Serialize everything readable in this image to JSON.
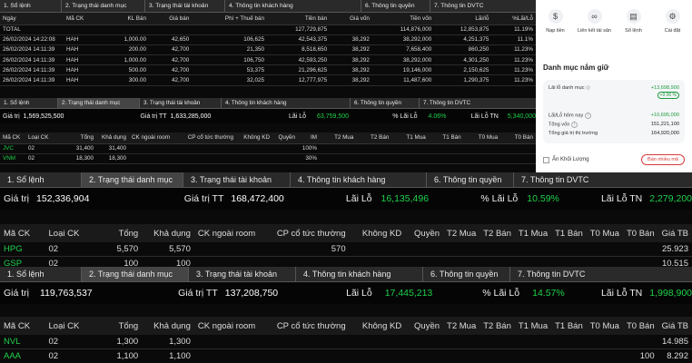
{
  "tabs": [
    "1. Sổ lệnh",
    "2. Trạng thái danh mục",
    "3. Trạng thái tài khoản",
    "4. Thông tin khách hàng",
    "6. Thông tin quyền",
    "7. Thông tin DVTC"
  ],
  "panel1": {
    "headers": [
      "Ngày",
      "Mã CK",
      "KL Bán",
      "Giá bán",
      "Phí + Thuế bán",
      "Tiền bán",
      "Giá vốn",
      "Tiền vốn",
      "Lãi/lỗ",
      "%Lãi/Lỗ"
    ],
    "total": {
      "label": "TOTAL",
      "tien_ban": "127,729,875",
      "tien_von": "114,876,000",
      "lai_lo": "12,853,875",
      "pct": "11.19%"
    },
    "rows": [
      {
        "date": "26/02/2024 14:22:08",
        "ma": "HAH",
        "kl": "1,000.00",
        "gia": "42,650",
        "phi": "106,625",
        "tien_ban": "42,543,375",
        "gia_von": "38,292",
        "tien_von": "38,292,000",
        "lai": "4,251,375",
        "pct": "11.1%"
      },
      {
        "date": "26/02/2024 14:11:39",
        "ma": "HAH",
        "kl": "200.00",
        "gia": "42,700",
        "phi": "21,350",
        "tien_ban": "8,518,650",
        "gia_von": "38,292",
        "tien_von": "7,658,400",
        "lai": "860,250",
        "pct": "11.23%"
      },
      {
        "date": "26/02/2024 14:11:39",
        "ma": "HAH",
        "kl": "1,000.00",
        "gia": "42,700",
        "phi": "106,750",
        "tien_ban": "42,593,250",
        "gia_von": "38,292",
        "tien_von": "38,292,000",
        "lai": "4,301,250",
        "pct": "11.23%"
      },
      {
        "date": "26/02/2024 14:11:39",
        "ma": "HAH",
        "kl": "500.00",
        "gia": "42,700",
        "phi": "53,375",
        "tien_ban": "21,296,625",
        "gia_von": "38,292",
        "tien_von": "19,146,000",
        "lai": "2,150,625",
        "pct": "11.23%"
      },
      {
        "date": "26/02/2024 14:11:39",
        "ma": "HAH",
        "kl": "300.00",
        "gia": "42,700",
        "phi": "32,025",
        "tien_ban": "12,777,975",
        "gia_von": "38,292",
        "tien_von": "11,487,600",
        "lai": "1,290,375",
        "pct": "11.23%"
      }
    ]
  },
  "panel2": {
    "summary": {
      "gtr_label": "Giá trị",
      "gtr": "1,569,525,500",
      "gtt_label": "Giá trị TT",
      "gtt": "1,633,285,000",
      "ll_label": "Lãi Lỗ",
      "ll": "63,759,500",
      "pll_label": "% Lãi Lỗ",
      "pll": "4.06%",
      "lltn_label": "Lãi Lỗ TN",
      "lltn": "5,340,000"
    },
    "headers": [
      "Mã CK",
      "Loại CK",
      "Tổng",
      "Khả dụng",
      "CK ngoài room",
      "CP cổ tức thường",
      "Không KD",
      "Quyền",
      "IM",
      "T2 Mua",
      "T2 Bán",
      "T1 Mua",
      "T1 Bán",
      "T0 Mua",
      "T0 Bán"
    ],
    "rows": [
      {
        "ma": "JVC",
        "loai": "02",
        "tong": "31,400",
        "kd": "31,400",
        "im": "100%"
      },
      {
        "ma": "VNM",
        "loai": "02",
        "tong": "18,300",
        "kd": "18,300",
        "im": "30%"
      }
    ]
  },
  "panel3": {
    "summary": {
      "gtr_label": "Giá trị",
      "gtr": "152,336,904",
      "gtt_label": "Giá trị TT",
      "gtt": "168,472,400",
      "ll_label": "Lãi Lỗ",
      "ll": "16,135,496",
      "pll_label": "% Lãi Lỗ",
      "pll": "10.59%",
      "lltn_label": "Lãi Lỗ TN",
      "lltn": "2,279,200"
    },
    "headers": [
      "Mã CK",
      "Loại CK",
      "Tổng",
      "Khả dụng",
      "CK ngoài room",
      "CP cổ tức thường",
      "Không KD",
      "Quyền",
      "T2 Mua",
      "T2 Bán",
      "T1 Mua",
      "T1 Bán",
      "T0 Mua",
      "T0 Bán",
      "Giá TB"
    ],
    "rows": [
      {
        "ma": "HPG",
        "loai": "02",
        "tong": "5,570",
        "kd": "5,570",
        "cp": "570",
        "giatb": "25.923"
      },
      {
        "ma": "GSP",
        "loai": "02",
        "tong": "100",
        "kd": "100",
        "cp": "",
        "giatb": "10.515"
      }
    ]
  },
  "panel4": {
    "summary": {
      "gtr_label": "Giá trị",
      "gtr": "119,763,537",
      "gtt_label": "Giá trị TT",
      "gtt": "137,208,750",
      "ll_label": "Lãi Lỗ",
      "ll": "17,445,213",
      "pll_label": "% Lãi Lỗ",
      "pll": "14.57%",
      "lltn_label": "Lãi Lỗ TN",
      "lltn": "1,998,900"
    },
    "headers": [
      "Mã CK",
      "Loại CK",
      "Tổng",
      "Khả dụng",
      "CK ngoài room",
      "CP cổ tức thường",
      "Không KD",
      "Quyền",
      "T2 Mua",
      "T2 Bán",
      "T1 Mua",
      "T1 Bán",
      "T0 Mua",
      "T0 Bán",
      "Giá TB"
    ],
    "rows": [
      {
        "ma": "NVL",
        "loai": "02",
        "tong": "1,300",
        "kd": "1,300",
        "t0ban": "",
        "giatb": "14.985"
      },
      {
        "ma": "AAA",
        "loai": "02",
        "tong": "1,100",
        "kd": "1,100",
        "t0ban": "100",
        "giatb": "8.292"
      }
    ]
  },
  "mobile": {
    "quick_actions": [
      {
        "icon": "coin-icon",
        "label": "Nạp tiền"
      },
      {
        "icon": "link-icon",
        "label": "Liên kết tài sản"
      },
      {
        "icon": "notebook-icon",
        "label": "Sổ lệnh"
      },
      {
        "icon": "gear-icon",
        "label": "Cài đặt"
      }
    ],
    "title": "Danh mục nắm giữ",
    "lai_lo_dm_label": "Lãi lỗ danh mục",
    "lai_lo_dm": "+13,698,900",
    "lai_lo_dm_pct": "+9.06 %",
    "lai_lo_hom_nay_label": "Lãi/Lỗ hôm nay",
    "lai_lo_hom_nay": "+10,695,000",
    "tong_von_label": "Tổng vốn",
    "tong_von": "151,221,100",
    "tong_gt_label": "Tổng giá trị thị trường",
    "tong_gt": "164,920,000",
    "hide_label": "Ẩn Khối Lượng",
    "sell_label": "Bán nhiều mã"
  }
}
